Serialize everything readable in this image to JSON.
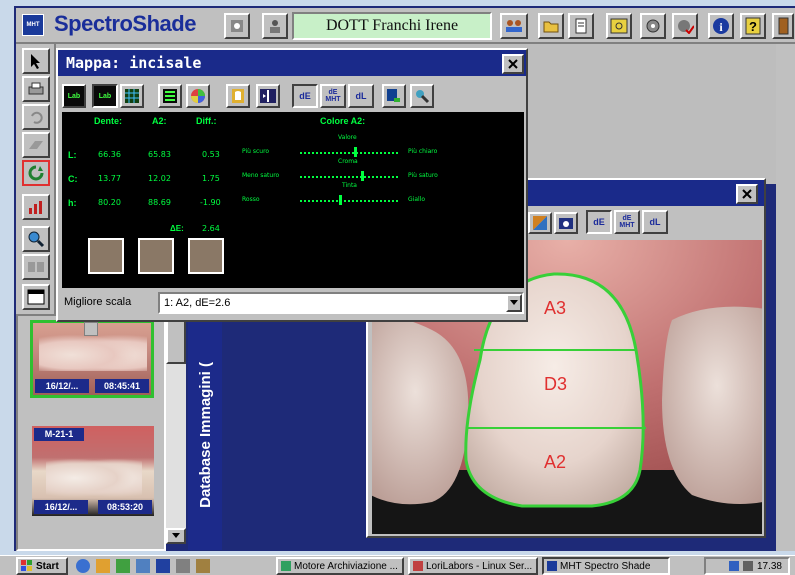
{
  "app": {
    "title": "SpectroShade",
    "logo": "MHT",
    "doctor": "DOTT Franchi Irene"
  },
  "top_toolbar": {
    "icons": [
      "people-icon",
      "folder-icon",
      "document-icon",
      "search-window-icon",
      "gear-scan-icon",
      "settings-check-icon",
      "info-icon",
      "help-icon",
      "exit-door-icon"
    ]
  },
  "left_tools": [
    "pointer-icon",
    "print-icon",
    "undo-icon",
    "eraser-icon",
    "refresh-icon",
    "chart-icon",
    "magnifier-icon",
    "compare-icon",
    "window-icon"
  ],
  "mappa": {
    "title": "Mappa: incisale",
    "toolbar": [
      "Lab",
      "Lab",
      "grid",
      "list",
      "color-wheel",
      "tooth",
      "split",
      "dE",
      "dE MHT",
      "dL",
      "export",
      "pick"
    ],
    "headers": {
      "dente": "Dente:",
      "a2": "A2:",
      "diff": "Diff.:",
      "colore": "Colore A2:"
    },
    "rows": [
      {
        "label": "L:",
        "dente": "66.36",
        "a2": "65.83",
        "diff": "0.53",
        "left": "Più scuro",
        "right": "Più chiaro",
        "top": "Valore",
        "bottom": "Croma",
        "marker": 0.55
      },
      {
        "label": "C:",
        "dente": "13.77",
        "a2": "12.02",
        "diff": "1.75",
        "left": "Meno saturo",
        "right": "Più saturo",
        "top": "",
        "bottom": "Tinta",
        "marker": 0.62
      },
      {
        "label": "h:",
        "dente": "80.20",
        "a2": "88.69",
        "diff": "-1.90",
        "left": "Rosso",
        "right": "Giallo",
        "top": "",
        "bottom": "",
        "marker": 0.4
      }
    ],
    "delta_label": "ΔE:",
    "delta_value": "2.64",
    "best_scale_label": "Migliore scala",
    "best_scale_value": "1: A2, dE=2.6"
  },
  "tooth_window": {
    "toolbar": [
      "dE",
      "dE MHT",
      "dL"
    ],
    "zones": [
      "A3",
      "D3",
      "A2"
    ]
  },
  "thumbnails": [
    {
      "id": "",
      "date": "16/12/...",
      "time": "08:45:41"
    },
    {
      "id": "M-21-1",
      "date": "16/12/...",
      "time": "08:53:20"
    }
  ],
  "database_label": "Database Immagini (",
  "taskbar": {
    "start": "Start",
    "tasks": [
      "Motore Archiviazione ...",
      "LoriLabors - Linux Ser...",
      "MHT Spectro Shade"
    ],
    "time": "17.38"
  }
}
